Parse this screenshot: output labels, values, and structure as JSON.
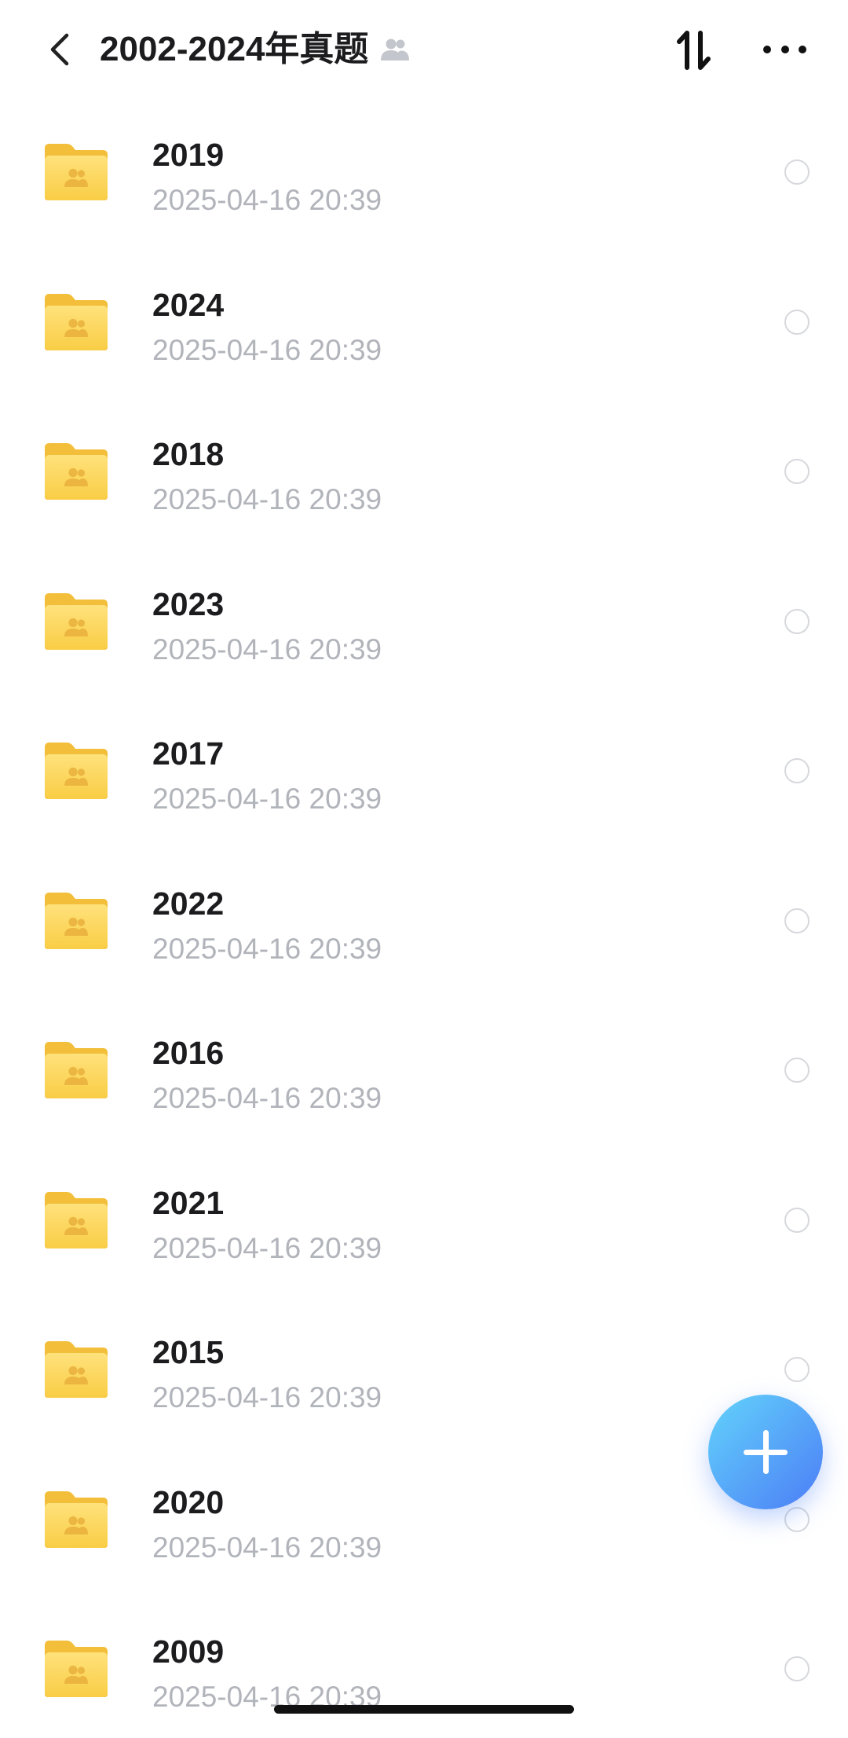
{
  "header": {
    "title": "2002-2024年真题",
    "icons": {
      "back": "chevron-left-icon",
      "shared": "shared-group-icon",
      "sort": "sort-icon",
      "more": "more-icon"
    }
  },
  "folders": [
    {
      "name": "2019",
      "date": "2025-04-16 20:39"
    },
    {
      "name": "2024",
      "date": "2025-04-16 20:39"
    },
    {
      "name": "2018",
      "date": "2025-04-16 20:39"
    },
    {
      "name": "2023",
      "date": "2025-04-16 20:39"
    },
    {
      "name": "2017",
      "date": "2025-04-16 20:39"
    },
    {
      "name": "2022",
      "date": "2025-04-16 20:39"
    },
    {
      "name": "2016",
      "date": "2025-04-16 20:39"
    },
    {
      "name": "2021",
      "date": "2025-04-16 20:39"
    },
    {
      "name": "2015",
      "date": "2025-04-16 20:39"
    },
    {
      "name": "2020",
      "date": "2025-04-16 20:39"
    },
    {
      "name": "2009",
      "date": "2025-04-16 20:39"
    }
  ],
  "folder_icon": "shared-folder-icon",
  "fab": {
    "icon": "plus-icon"
  },
  "colors": {
    "title_text": "#1c1c1e",
    "date_text": "#b1b4ba",
    "folder_yellow": "#f9cd45",
    "fab_gradient_start": "#63d3fb",
    "fab_gradient_end": "#4c7df6"
  }
}
